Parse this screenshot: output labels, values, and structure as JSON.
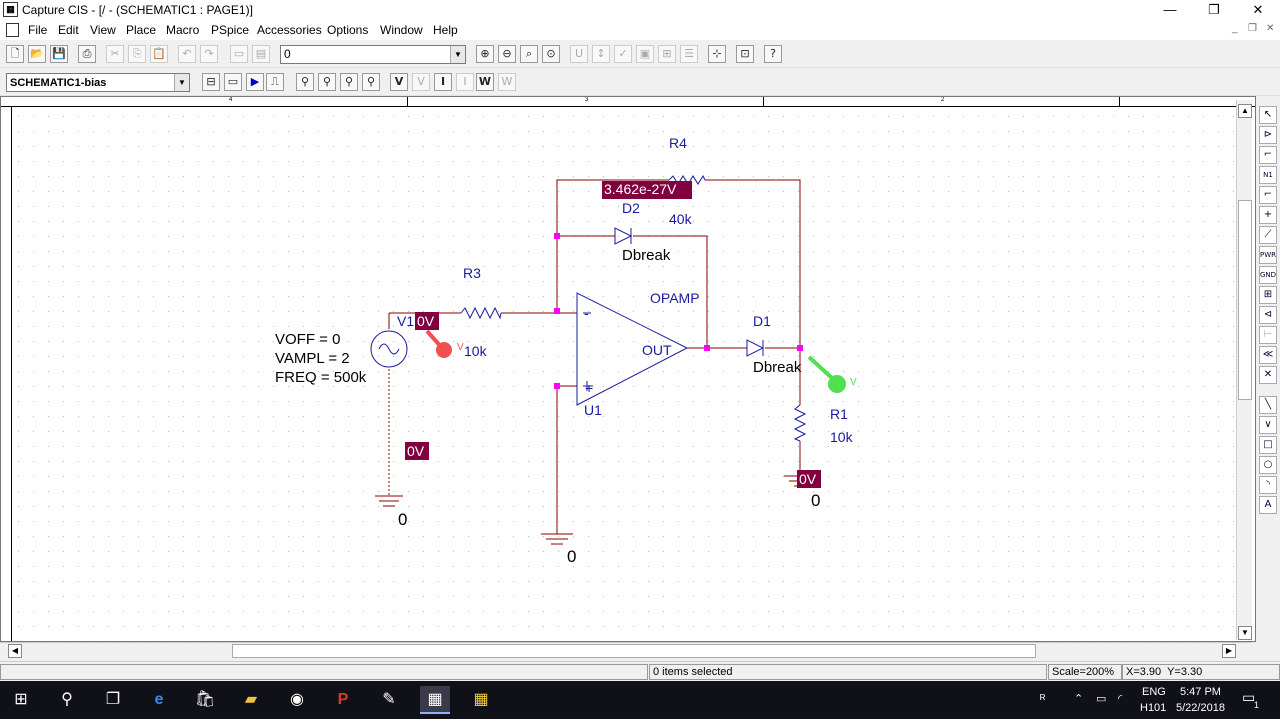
{
  "window": {
    "title": "Capture CIS - [/ - (SCHEMATIC1 : PAGE1)]",
    "controls": {
      "minimize": "—",
      "restore": "❐",
      "close": "✕"
    }
  },
  "menu": {
    "items": [
      "File",
      "Edit",
      "View",
      "Place",
      "Macro",
      "PSpice",
      "Accessories",
      "Options",
      "Window",
      "Help"
    ],
    "mdi_controls": {
      "minimize": "_",
      "restore": "❐",
      "close": "✕"
    }
  },
  "toolbar1": {
    "search_value": "0"
  },
  "toolbar2": {
    "profile_value": "SCHEMATIC1-bias"
  },
  "ruler": {
    "labels": [
      "4",
      "3",
      "2"
    ]
  },
  "schematic": {
    "R4": {
      "name": "R4",
      "value": "40k"
    },
    "R3": {
      "name": "R3",
      "value": "10k"
    },
    "R1": {
      "name": "R1",
      "value": "10k"
    },
    "D2": {
      "name": "D2",
      "model": "Dbreak"
    },
    "D1": {
      "name": "D1",
      "model": "Dbreak"
    },
    "U1": {
      "name": "U1",
      "model": "OPAMP",
      "out_label": "OUT",
      "minus": "-",
      "plus": "+"
    },
    "V1": {
      "name": "V1",
      "voff": "VOFF = 0",
      "vampl": "VAMPL = 2",
      "freq": "FREQ = 500k"
    },
    "bias_voltages": {
      "r4": "3.462e-27V",
      "v1_top": "0V",
      "v1_bottom": "0V",
      "r1": "0V"
    },
    "ground_labels": {
      "g1": "0",
      "g2": "0",
      "g3": "0"
    },
    "probes": {
      "p1": "V",
      "p2": "V"
    },
    "colors": {
      "wire": "#8b0000",
      "part": "#1a1aa0",
      "node": "#ff00ff",
      "bias_bg": "#800040",
      "probe_red": "#f05050",
      "probe_green": "#50e050"
    }
  },
  "status": {
    "selection": "0 items selected",
    "scale": "Scale=200%",
    "coords": "X=3.90  Y=3.30"
  },
  "taskbar": {
    "lang": "ENG",
    "lang2": "H101",
    "time": "5:47 PM",
    "date": "5/22/2018",
    "notif_count": "1"
  }
}
